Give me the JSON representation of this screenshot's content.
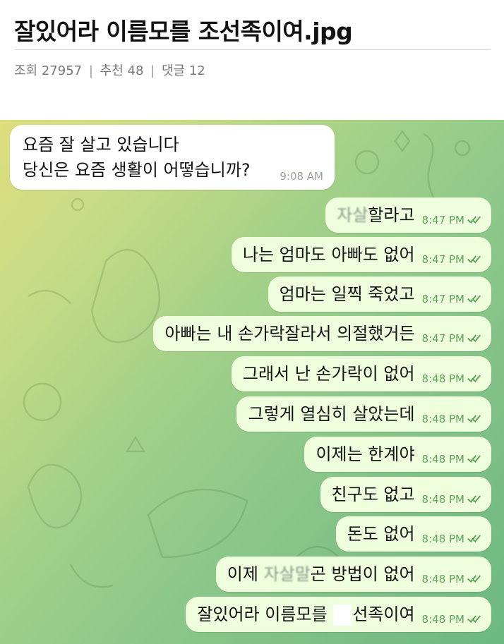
{
  "post": {
    "title": "잘있어라 이름모를 조선족이여.jpg",
    "views_label": "조회",
    "views": "27957",
    "likes_label": "추천",
    "likes": "48",
    "comments_label": "댓글",
    "comments": "12",
    "separator": "|"
  },
  "chat": {
    "incoming": {
      "line1": "요즘 잘 살고 있습니다",
      "line2": "당신은 요즘 생활이 어떻습니까?",
      "time": "9:08 AM"
    },
    "outgoing": [
      {
        "pre": "",
        "blur": "자살",
        "post": "할라고",
        "time": "8:47 PM"
      },
      {
        "pre": "나는 엄마도 아빠도 없어",
        "blur": "",
        "post": "",
        "time": "8:47 PM"
      },
      {
        "pre": "엄마는 일찍 죽었고",
        "blur": "",
        "post": "",
        "time": "8:47 PM"
      },
      {
        "pre": "아빠는 내 손가락잘라서 의절했거든",
        "blur": "",
        "post": "",
        "time": "8:47 PM"
      },
      {
        "pre": "그래서 난 손가락이 없어",
        "blur": "",
        "post": "",
        "time": "8:48 PM"
      },
      {
        "pre": "그렇게 열심히 살았는데",
        "blur": "",
        "post": "",
        "time": "8:48 PM"
      },
      {
        "pre": "이제는 한계야",
        "blur": "",
        "post": "",
        "time": "8:48 PM"
      },
      {
        "pre": "친구도 없고",
        "blur": "",
        "post": "",
        "time": "8:48 PM"
      },
      {
        "pre": "돈도 없어",
        "blur": "",
        "post": "",
        "time": "8:48 PM"
      },
      {
        "pre": "이제 ",
        "blur": "자살말",
        "post": "곤 방법이 없어",
        "time": "8:48 PM"
      },
      {
        "pre": "잘있어라 이름모를 ",
        "blur": "",
        "post": "선족이여",
        "time": "8:48 PM",
        "redacted": true
      }
    ],
    "read_icon": "double-check-icon"
  },
  "colors": {
    "outgoing_bubble": "#efffde",
    "incoming_bubble": "#ffffff",
    "timestamp_green": "#5fa55a",
    "wallpaper_yellow": "#dede7c",
    "wallpaper_green": "#6db882"
  }
}
